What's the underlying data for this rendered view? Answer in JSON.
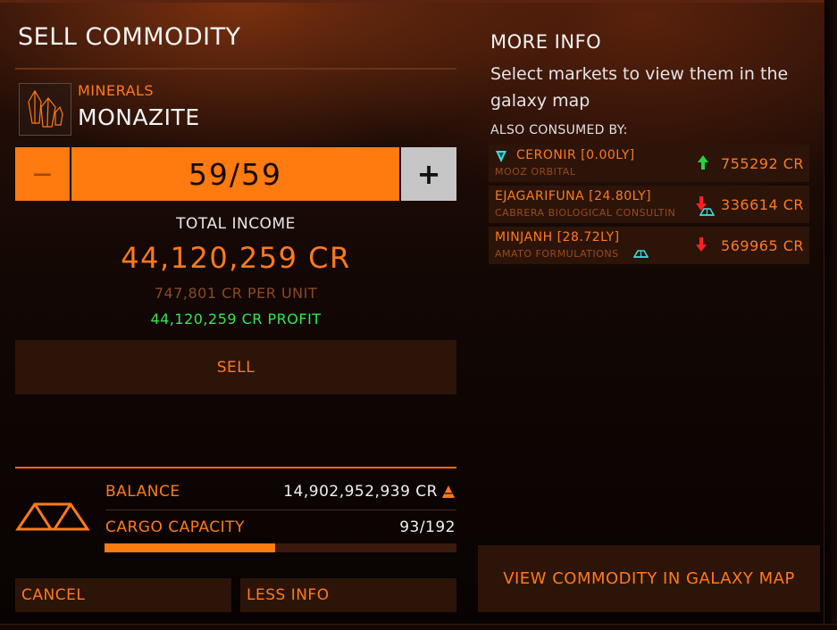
{
  "panel": {
    "title": "SELL COMMODITY",
    "category": "MINERALS",
    "commodity": "MONAZITE",
    "quantity": "59/59",
    "minus_label": "−",
    "plus_label": "+",
    "total_income_label": "TOTAL INCOME",
    "total_income_value": "44,120,259 CR",
    "per_unit": "747,801 CR PER UNIT",
    "profit": "44,120,259 CR PROFIT",
    "sell_label": "SELL",
    "balance_label": "BALANCE",
    "balance_value": "14,902,952,939 CR",
    "cargo_label": "CARGO CAPACITY",
    "cargo_value": "93/192",
    "cargo_fill_fraction": 0.484,
    "cancel_label": "CANCEL",
    "less_info_label": "LESS INFO"
  },
  "more_info": {
    "title": "MORE INFO",
    "description": "Select markets to view them in the galaxy map",
    "also_consumed_label": "ALSO CONSUMED BY:",
    "markets": [
      {
        "name": "CERONIR [0.00LY]",
        "station": "MOOZ ORBITAL",
        "price": "755292 CR",
        "trend": "up",
        "icon": "beacon-icon"
      },
      {
        "name": "EJAGARIFUNA [24.80LY]",
        "station": "CABRERA BIOLOGICAL CONSULTIN",
        "price": "336614 CR",
        "trend": "down",
        "icon": "surface-port-icon"
      },
      {
        "name": "MINJANH [28.72LY]",
        "station": "AMATO FORMULATIONS",
        "price": "569965 CR",
        "trend": "down",
        "icon": "surface-port-icon"
      }
    ],
    "galaxy_button_label": "VIEW COMMODITY IN GALAXY MAP"
  },
  "colors": {
    "accent": "#ff7a0f",
    "button_bg": "#2c1409",
    "profit_green": "#35e84a",
    "trend_up": "#2bd23a",
    "trend_down": "#ff2020",
    "station_cyan": "#36e0e0"
  }
}
